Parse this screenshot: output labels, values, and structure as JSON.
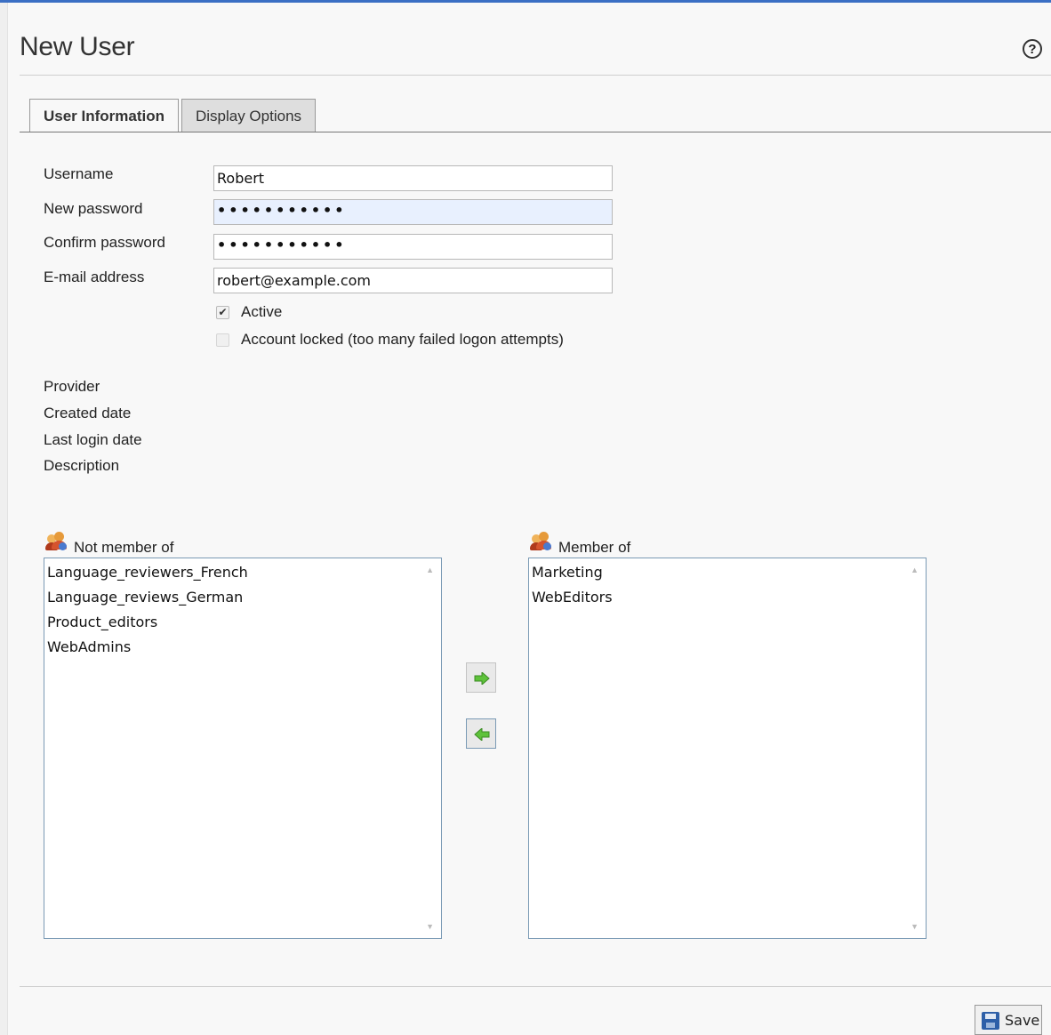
{
  "page": {
    "title": "New User",
    "help_icon": "?"
  },
  "tabs": [
    {
      "label": "User Information",
      "active": true
    },
    {
      "label": "Display Options",
      "active": false
    }
  ],
  "form": {
    "username": {
      "label": "Username",
      "value": "Robert"
    },
    "new_password": {
      "label": "New password",
      "value": "•••••••••••"
    },
    "confirm_password": {
      "label": "Confirm password",
      "value": "•••••••••••"
    },
    "email": {
      "label": "E-mail address",
      "value": "robert@example.com"
    },
    "active": {
      "label": "Active",
      "checked": true
    },
    "locked": {
      "label": "Account locked (too many failed logon attempts)",
      "checked": false,
      "disabled": true
    }
  },
  "info": {
    "provider": "Provider",
    "created_date": "Created date",
    "last_login_date": "Last login date",
    "description": "Description"
  },
  "groups": {
    "not_member_label": "Not member of",
    "not_member": [
      "Language_reviewers_French",
      "Language_reviews_German",
      "Product_editors",
      "WebAdmins"
    ],
    "member_label": "Member of",
    "member": [
      "Marketing",
      "WebEditors"
    ],
    "icon": "users-group-icon"
  },
  "actions": {
    "add_icon": "arrow-right-icon",
    "remove_icon": "arrow-left-icon",
    "save_label": "Save",
    "save_icon": "floppy-disk-icon"
  },
  "colors": {
    "accent": "#3b6fc4",
    "arrow_green": "#5ec23a",
    "list_border": "#7a9ab5"
  }
}
